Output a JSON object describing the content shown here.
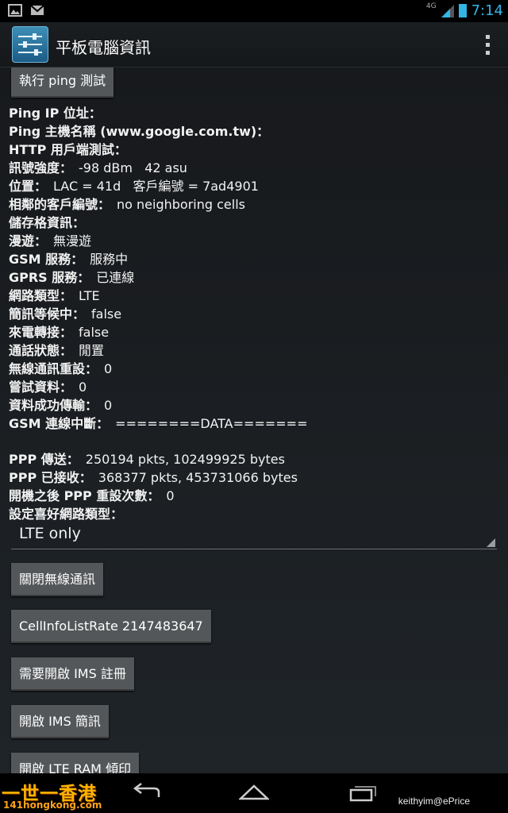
{
  "status_bar": {
    "left_icons": [
      "image-icon",
      "gmail-icon"
    ],
    "network": "4G",
    "time": "7:14",
    "accent": "#33b5e5"
  },
  "action_bar": {
    "title": "平板電腦資訊",
    "app_icon": "settings-sliders-icon"
  },
  "content": {
    "ping_button": "執行 ping 測試",
    "info": [
      {
        "label": "Ping IP 位址：",
        "value": ""
      },
      {
        "label": "Ping 主機名稱 (www.google.com.tw)：",
        "value": ""
      },
      {
        "label": "HTTP 用戶端測試：",
        "value": ""
      },
      {
        "label": "訊號強度：",
        "value": "-98 dBm   42 asu"
      },
      {
        "label": "位置：",
        "value": "LAC = 41d   客戶編號 = 7ad4901"
      },
      {
        "label": "相鄰的客戶編號：",
        "value": "no neighboring cells"
      },
      {
        "label": "儲存格資訊：",
        "value": ""
      },
      {
        "label": "漫遊：",
        "value": "無漫遊"
      },
      {
        "label": "GSM 服務：",
        "value": "服務中"
      },
      {
        "label": "GPRS 服務：",
        "value": "已連線"
      },
      {
        "label": "網路類型：",
        "value": "LTE"
      },
      {
        "label": "簡訊等候中：",
        "value": "false"
      },
      {
        "label": "來電轉接：",
        "value": "false"
      },
      {
        "label": "通話狀態：",
        "value": "閒置"
      },
      {
        "label": "無線通訊重設：",
        "value": "0"
      },
      {
        "label": "嘗試資料：",
        "value": "0"
      },
      {
        "label": "資料成功傳輸：",
        "value": "0"
      },
      {
        "label": "GSM 連線中斷：",
        "value": "========DATA======="
      }
    ],
    "ppp": [
      {
        "label": "PPP 傳送：",
        "value": "250194 pkts, 102499925 bytes"
      },
      {
        "label": "PPP 已接收：",
        "value": "368377 pkts, 453731066 bytes"
      },
      {
        "label": "開機之後 PPP 重設次數：",
        "value": "0"
      },
      {
        "label": "設定喜好網路類型：",
        "value": ""
      }
    ],
    "network_type_selected": "LTE only",
    "buttons": [
      "關閉無線通訊",
      "CellInfoListRate 2147483647",
      "需要開啟 IMS 註冊",
      "開啟 IMS 簡訊",
      "開啟 LTE RAM 傾印"
    ]
  },
  "nav_bar": {
    "watermark_logo_line1": "一世一香港",
    "watermark_logo_line2": "141hongkong.com",
    "credit": "keithyim@ePrice"
  }
}
